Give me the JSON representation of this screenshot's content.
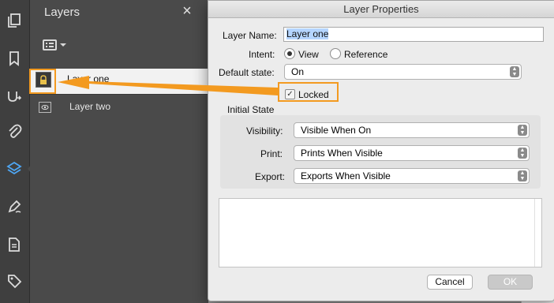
{
  "colors": {
    "accent_orange": "#f39a20",
    "panel_bg": "#4a4a4a",
    "rail_bg": "#3f3f3f",
    "dialog_bg": "#ececec"
  },
  "rail": {
    "icons": [
      "pages-icon",
      "bookmark-icon",
      "signatures-icon",
      "attachment-icon",
      "layers-icon",
      "edit-sign-icon",
      "document-icon",
      "tag-icon"
    ]
  },
  "layers_panel": {
    "title": "Layers",
    "close_glyph": "×",
    "layers": [
      {
        "name": "Layer one",
        "selected": true,
        "locked": true
      },
      {
        "name": "Layer two",
        "selected": false,
        "locked": false
      }
    ]
  },
  "dialog": {
    "title": "Layer Properties",
    "layer_name_label": "Layer Name:",
    "layer_name_value": "Layer one",
    "intent_label": "Intent:",
    "intent_options": [
      "View",
      "Reference"
    ],
    "intent_selected": "View",
    "default_state_label": "Default state:",
    "default_state_value": "On",
    "locked_label": "Locked",
    "locked_checked": true,
    "initial_state_label": "Initial State",
    "visibility_label": "Visibility:",
    "visibility_value": "Visible When On",
    "print_label": "Print:",
    "print_value": "Prints When Visible",
    "export_label": "Export:",
    "export_value": "Exports When Visible",
    "cancel_label": "Cancel",
    "ok_label": "OK"
  }
}
